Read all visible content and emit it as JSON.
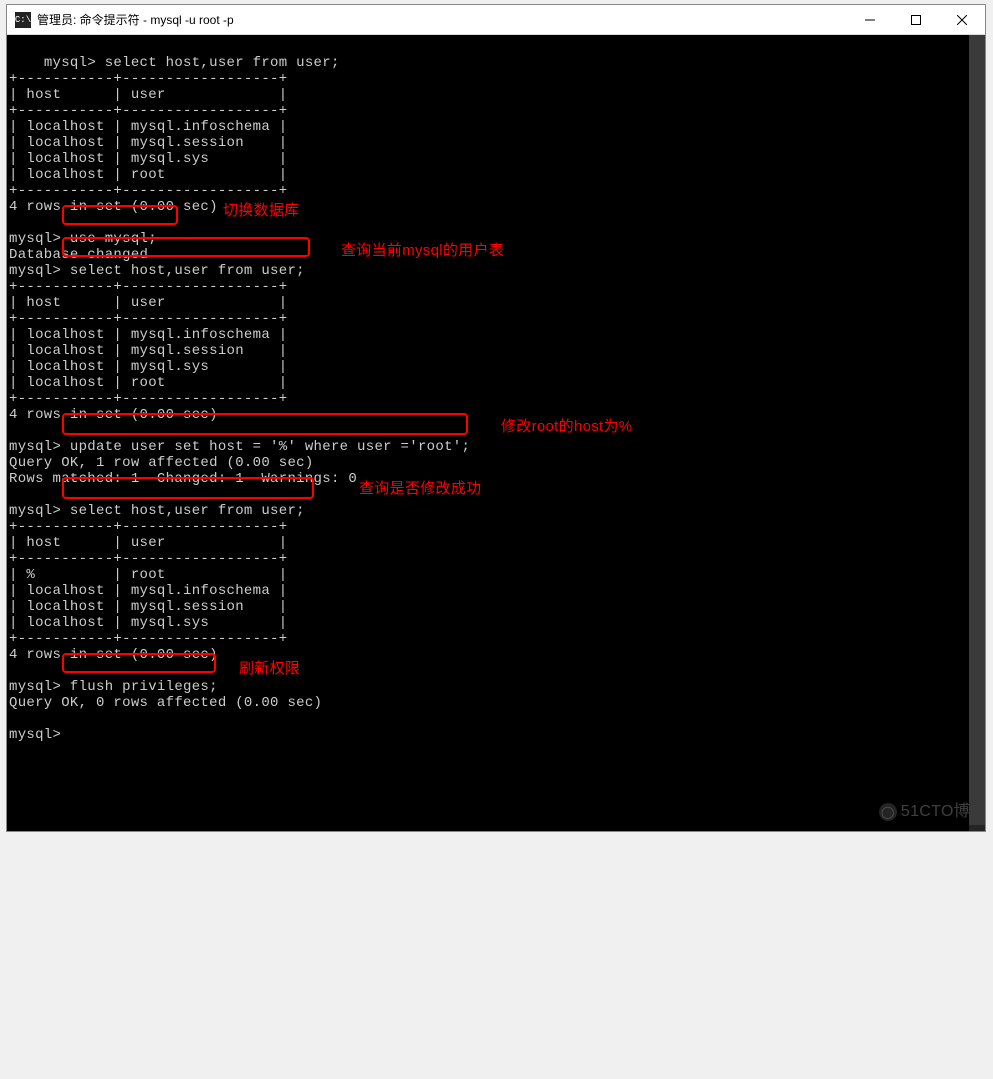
{
  "window": {
    "icon_text": "C:\\",
    "title": "管理员: 命令提示符 - mysql  -u root -p"
  },
  "terminal": {
    "content": "mysql> select host,user from user;\n+-----------+------------------+\n| host      | user             |\n+-----------+------------------+\n| localhost | mysql.infoschema |\n| localhost | mysql.session    |\n| localhost | mysql.sys        |\n| localhost | root             |\n+-----------+------------------+\n4 rows in set (0.00 sec)\n\nmysql> use mysql;\nDatabase changed\nmysql> select host,user from user;\n+-----------+------------------+\n| host      | user             |\n+-----------+------------------+\n| localhost | mysql.infoschema |\n| localhost | mysql.session    |\n| localhost | mysql.sys        |\n| localhost | root             |\n+-----------+------------------+\n4 rows in set (0.00 sec)\n\nmysql> update user set host = '%' where user ='root';\nQuery OK, 1 row affected (0.00 sec)\nRows matched: 1  Changed: 1  Warnings: 0\n\nmysql> select host,user from user;\n+-----------+------------------+\n| host      | user             |\n+-----------+------------------+\n| %         | root             |\n| localhost | mysql.infoschema |\n| localhost | mysql.session    |\n| localhost | mysql.sys        |\n+-----------+------------------+\n4 rows in set (0.00 sec)\n\nmysql> flush privileges;\nQuery OK, 0 rows affected (0.00 sec)\n\nmysql>"
  },
  "annotations": {
    "a1_label": "切换数据库",
    "a2_label": "查询当前mysql的用户表",
    "a3_label": "修改root的host为%",
    "a4_label": "查询是否修改成功",
    "a5_label": "刷新权限"
  },
  "watermark": "51CTO博"
}
